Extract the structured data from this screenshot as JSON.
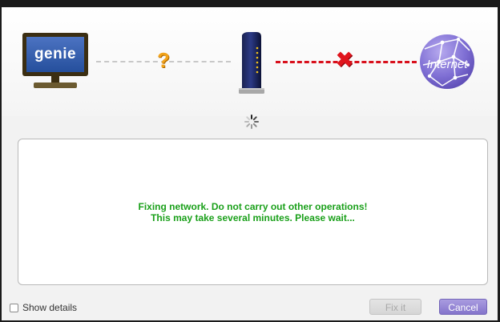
{
  "diagram": {
    "computer_label": "genie",
    "computer_icon": "monitor-icon",
    "router_icon": "router-icon",
    "internet_label": "Internet",
    "internet_icon": "globe-icon",
    "computer_router_status": "unknown",
    "router_internet_status": "disconnected",
    "question_glyph": "?",
    "error_glyph": "✖",
    "colors": {
      "unknown_line": "#c8c8c8",
      "error_line": "#d8101c",
      "question": "#f2a31a",
      "error": "#e0141c"
    }
  },
  "spinner": {
    "icon": "loading-spinner-icon"
  },
  "message": {
    "line1": "Fixing network. Do not carry out other operations!",
    "line2": "This may take several minutes. Please wait...",
    "color": "#1aa01a"
  },
  "footer": {
    "show_details_label": "Show details",
    "show_details_checked": false,
    "fix_it_label": "Fix it",
    "fix_it_enabled": false,
    "cancel_label": "Cancel",
    "cancel_color": "#8474cb"
  }
}
